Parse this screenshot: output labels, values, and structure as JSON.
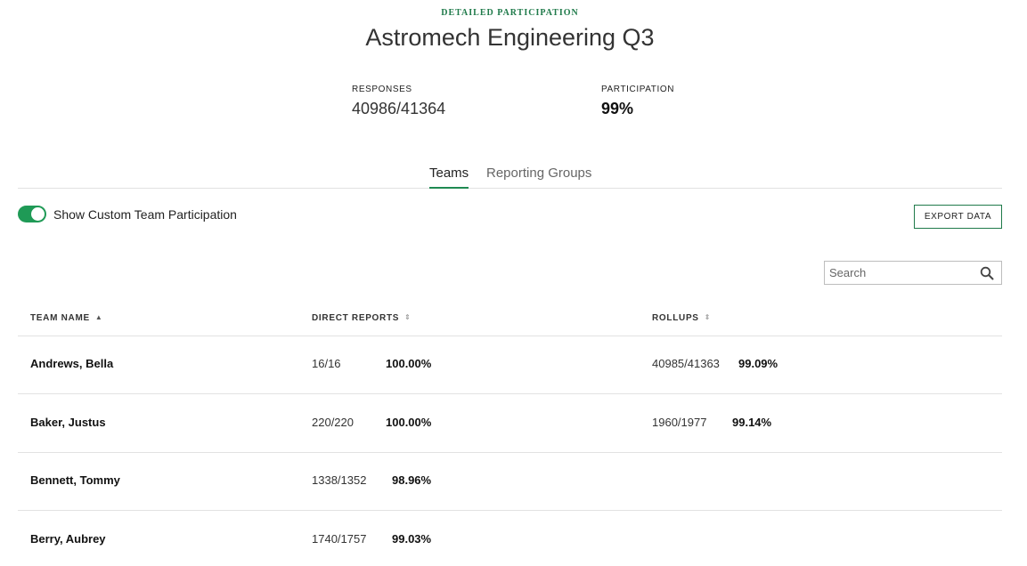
{
  "header": {
    "eyebrow": "DETAILED PARTICIPATION",
    "title": "Astromech Engineering Q3"
  },
  "stats": {
    "responses_label": "RESPONSES",
    "responses_value": "40986/41364",
    "participation_label": "PARTICIPATION",
    "participation_value": "99%"
  },
  "tabs": [
    {
      "label": "Teams",
      "active": true
    },
    {
      "label": "Reporting Groups",
      "active": false
    }
  ],
  "toggle": {
    "label": "Show Custom Team Participation",
    "on": true,
    "color": "#1f9a56"
  },
  "export_button": {
    "label": "EXPORT DATA"
  },
  "search": {
    "placeholder": "Search",
    "value": "",
    "icon": "search-icon"
  },
  "table": {
    "columns": [
      {
        "label": "TEAM NAME",
        "sort": "ascending"
      },
      {
        "label": "DIRECT REPORTS",
        "sort": "none"
      },
      {
        "label": "ROLLUPS",
        "sort": "none"
      }
    ],
    "rows": [
      {
        "name": "Andrews, Bella",
        "direct_count": "16/16",
        "direct_pct": "100.00%",
        "rollup_count": "40985/41363",
        "rollup_pct": "99.09%"
      },
      {
        "name": "Baker, Justus",
        "direct_count": "220/220",
        "direct_pct": "100.00%",
        "rollup_count": "1960/1977",
        "rollup_pct": "99.14%"
      },
      {
        "name": "Bennett, Tommy",
        "direct_count": "1338/1352",
        "direct_pct": "98.96%",
        "rollup_count": "",
        "rollup_pct": ""
      },
      {
        "name": "Berry, Aubrey",
        "direct_count": "1740/1757",
        "direct_pct": "99.03%",
        "rollup_count": "",
        "rollup_pct": ""
      }
    ]
  },
  "colors": {
    "accent": "#1f7a4a",
    "toggle_on": "#1f9a56",
    "divider": "#e2e2e2"
  }
}
